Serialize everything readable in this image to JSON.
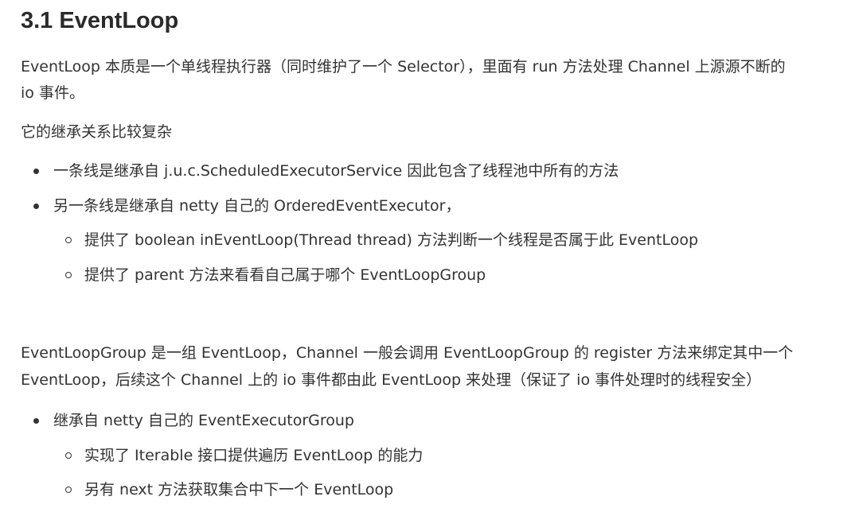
{
  "heading": "3.1 EventLoop",
  "para1": {
    "line1": "EventLoop 本质是一个单线程执行器（同时维护了一个 Selector），里面有 run 方法处理 Channel 上源源不断的",
    "line2": "io 事件。"
  },
  "para2": "它的继承关系比较复杂",
  "list1": {
    "items": [
      {
        "text": "一条线是继承自 j.u.c.ScheduledExecutorService 因此包含了线程池中所有的方法",
        "children": []
      },
      {
        "text": "另一条线是继承自 netty 自己的 OrderedEventExecutor，",
        "children": [
          "提供了 boolean inEventLoop(Thread thread) 方法判断一个线程是否属于此 EventLoop",
          "提供了 parent 方法来看看自己属于哪个 EventLoopGroup"
        ]
      }
    ]
  },
  "para3": {
    "line1": "EventLoopGroup 是一组 EventLoop，Channel 一般会调用 EventLoopGroup 的 register 方法来绑定其中一个",
    "line2": "EventLoop，后续这个 Channel 上的 io 事件都由此 EventLoop 来处理（保证了 io 事件处理时的线程安全）"
  },
  "list2": {
    "items": [
      {
        "text": "继承自 netty 自己的 EventExecutorGroup",
        "children": [
          "实现了 Iterable 接口提供遍历 EventLoop 的能力",
          "另有 next 方法获取集合中下一个 EventLoop"
        ]
      }
    ]
  }
}
